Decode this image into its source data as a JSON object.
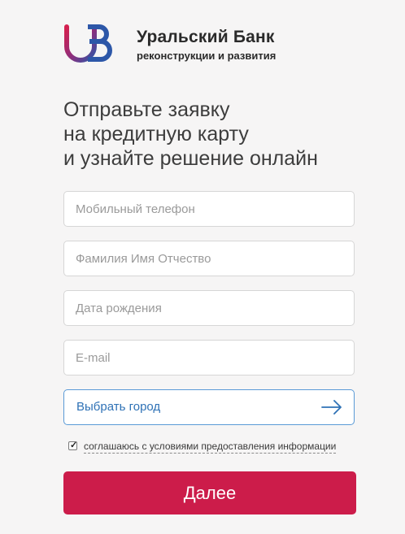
{
  "brand": {
    "title": "Уральский Банк",
    "subtitle": "реконструкции и развития",
    "logo_icon": "ubrr-logo-icon",
    "colors": {
      "logo_red": "#d4204f",
      "logo_blue": "#2d57a8",
      "logo_purple": "#8a2f7e"
    }
  },
  "heading": {
    "line1": "Отправьте заявку",
    "line2": "на кредитную карту",
    "line3": "и узнайте решение онлайн"
  },
  "form": {
    "phone_placeholder": "Мобильный телефон",
    "fullname_placeholder": "Фамилия Имя Отчество",
    "birthdate_placeholder": "Дата рождения",
    "email_placeholder": "E-mail",
    "city_label": "Выбрать город",
    "city_icon": "arrow-right-icon",
    "consent_checked": true,
    "consent_text": "соглашаюсь с условиями предоставления информации",
    "submit_label": "Далее"
  },
  "colors": {
    "accent": "#cc1c4a",
    "link": "#2f72b6",
    "field_border": "#d6d6d6",
    "focus_border": "#5a9ad6"
  }
}
